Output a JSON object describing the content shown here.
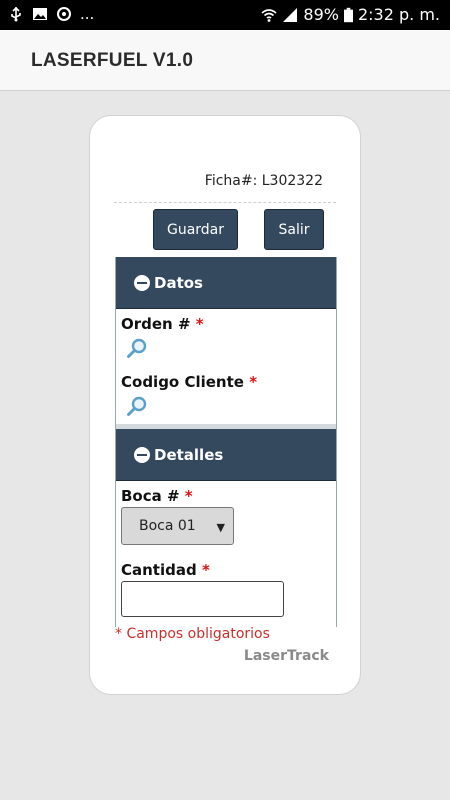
{
  "status_bar": {
    "left_icons": [
      "usb-icon",
      "image-icon",
      "sync-icon"
    ],
    "more": "...",
    "battery": "89%",
    "time": "2:32 p. m."
  },
  "app_bar": {
    "title": "LASERFUEL V1.0"
  },
  "card": {
    "ficha_label": "Ficha#: L302322",
    "buttons": {
      "guardar": "Guardar",
      "salir": "Salir"
    },
    "sections": {
      "datos": {
        "title": "Datos",
        "fields": [
          {
            "label": "Orden #",
            "required": "*"
          },
          {
            "label": "Codigo Cliente",
            "required": "*"
          }
        ]
      },
      "detalles": {
        "title": "Detalles",
        "boca": {
          "label": "Boca #",
          "required": "*",
          "selected": "Boca 01"
        },
        "cantidad": {
          "label": "Cantidad",
          "required": "*",
          "value": ""
        }
      }
    },
    "required_note": "* Campos obligatorios",
    "brand": "LaserTrack"
  },
  "colors": {
    "header_bg": "#34495e",
    "required": "#d11111",
    "status_bar": "#000000"
  }
}
